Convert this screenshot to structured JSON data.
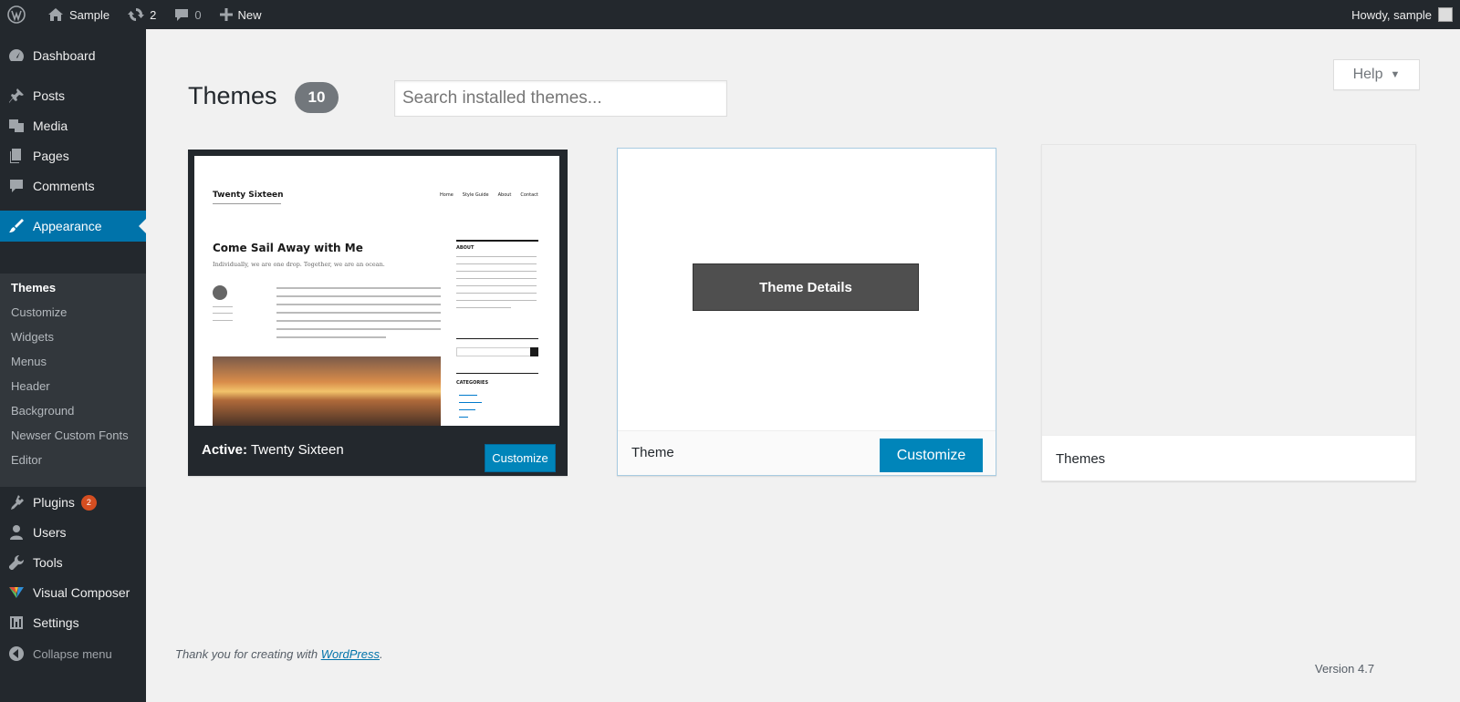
{
  "adminbar": {
    "site_name": "Sample",
    "updates_count": "2",
    "comments_count": "0",
    "new_label": "New",
    "howdy": "Howdy, sample"
  },
  "sidebar": {
    "items": [
      {
        "label": "Dashboard",
        "icon": "dashboard-icon"
      },
      {
        "label": "Posts",
        "icon": "pushpin-icon"
      },
      {
        "label": "Media",
        "icon": "media-icon"
      },
      {
        "label": "Pages",
        "icon": "pages-icon"
      },
      {
        "label": "Comments",
        "icon": "comment-icon"
      },
      {
        "label": "Appearance",
        "icon": "paintbrush-icon"
      },
      {
        "label": "Plugins",
        "icon": "plugin-icon",
        "badge": "2"
      },
      {
        "label": "Users",
        "icon": "user-icon"
      },
      {
        "label": "Tools",
        "icon": "wrench-icon"
      },
      {
        "label": "Visual Composer",
        "icon": "visual-composer-icon"
      },
      {
        "label": "Settings",
        "icon": "settings-icon"
      },
      {
        "label": "Collapse menu",
        "icon": "collapse-icon"
      }
    ],
    "appearance_sub": [
      "Themes",
      "Customize",
      "Widgets",
      "Menus",
      "Header",
      "Background",
      "Newser Custom Fonts",
      "Editor"
    ]
  },
  "main": {
    "title": "Themes",
    "count": "10",
    "search_placeholder": "Search installed themes...",
    "help_label": "Help"
  },
  "themes": {
    "active": {
      "prefix": "Active:",
      "name": "Twenty Sixteen",
      "customize": "Customize",
      "screenshot": {
        "site_title": "Twenty Sixteen",
        "nav": [
          "Home",
          "Style Guide",
          "About",
          "Contact"
        ],
        "post_title": "Come Sail Away with Me",
        "post_subtitle": "Individually, we are one drop. Together, we are an ocean.",
        "about_label": "ABOUT",
        "categories_label": "CATEGORIES"
      }
    },
    "second": {
      "details": "Theme Details",
      "name": "Theme",
      "customize": "Customize"
    },
    "third": {
      "name": "Themes"
    }
  },
  "footer": {
    "thanks_prefix": "Thank you for creating with ",
    "thanks_link": "WordPress",
    "thanks_suffix": ".",
    "version": "Version 4.7"
  }
}
